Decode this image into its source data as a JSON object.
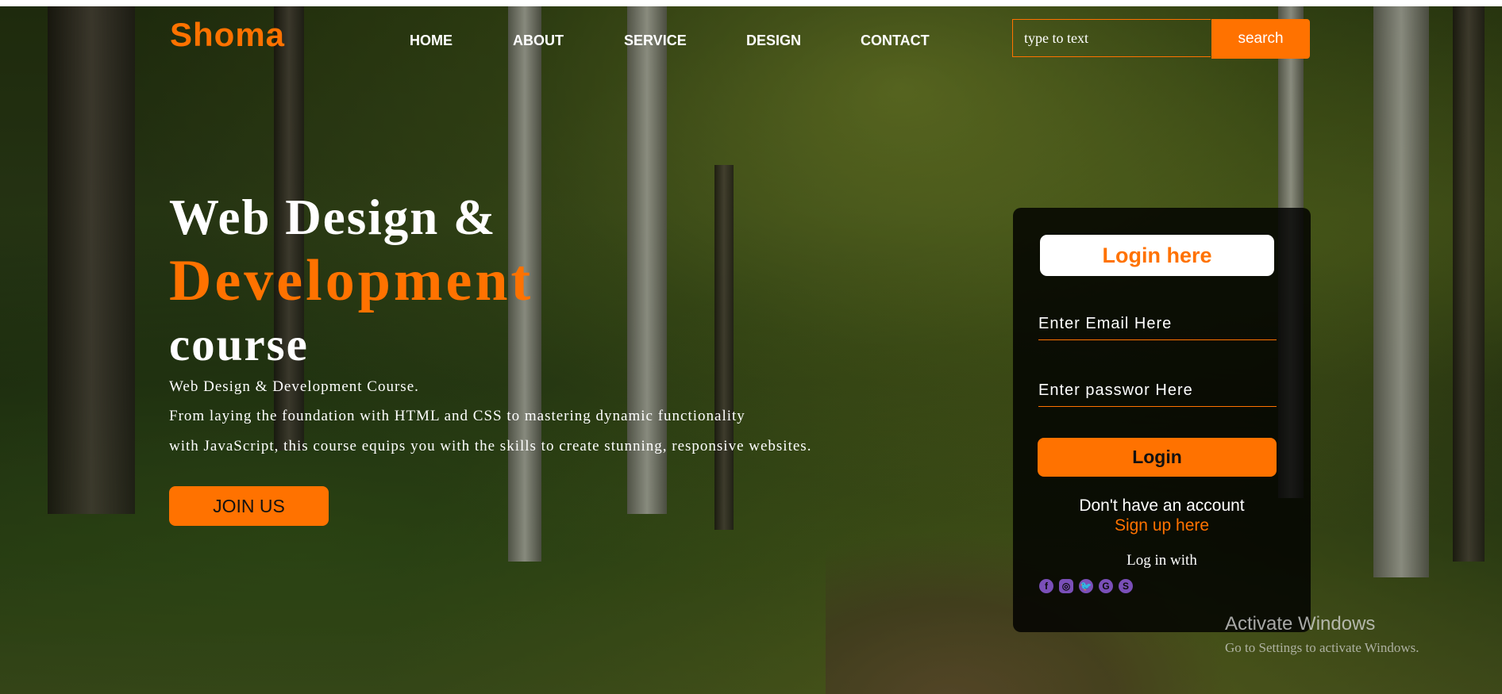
{
  "brand": "Shoma",
  "nav": [
    {
      "label": "HOME"
    },
    {
      "label": "ABOUT"
    },
    {
      "label": "SERVICE"
    },
    {
      "label": "DESIGN"
    },
    {
      "label": "CONTACT"
    }
  ],
  "search": {
    "placeholder": "type to text",
    "button_label": "search"
  },
  "hero": {
    "line1": "Web Design &",
    "line2": "Development",
    "line3": "course",
    "desc1": "Web Design & Development Course.",
    "desc2": "From laying the foundation with HTML and CSS to mastering dynamic functionality",
    "desc3": "with JavaScript, this course equips you with the skills to create stunning, responsive websites.",
    "join_label": "JOIN US"
  },
  "login": {
    "title": "Login here",
    "email_placeholder": "Enter Email Here",
    "password_placeholder": "Enter passwor Here",
    "button_label": "Login",
    "no_account": "Don't have an account",
    "signup_label": "Sign up here",
    "login_with": "Log in with",
    "socials": [
      {
        "icon": "facebook-icon",
        "glyph": "f"
      },
      {
        "icon": "instagram-icon",
        "glyph": "◎"
      },
      {
        "icon": "twitter-icon",
        "glyph": "🐦"
      },
      {
        "icon": "google-icon",
        "glyph": "G"
      },
      {
        "icon": "skype-icon",
        "glyph": "S"
      }
    ]
  },
  "watermark": {
    "title": "Activate Windows",
    "subtitle": "Go to Settings to activate Windows."
  },
  "colors": {
    "accent": "#ff7200",
    "card": "#000000",
    "text": "#ffffff",
    "icon": "#7a4fb8"
  }
}
